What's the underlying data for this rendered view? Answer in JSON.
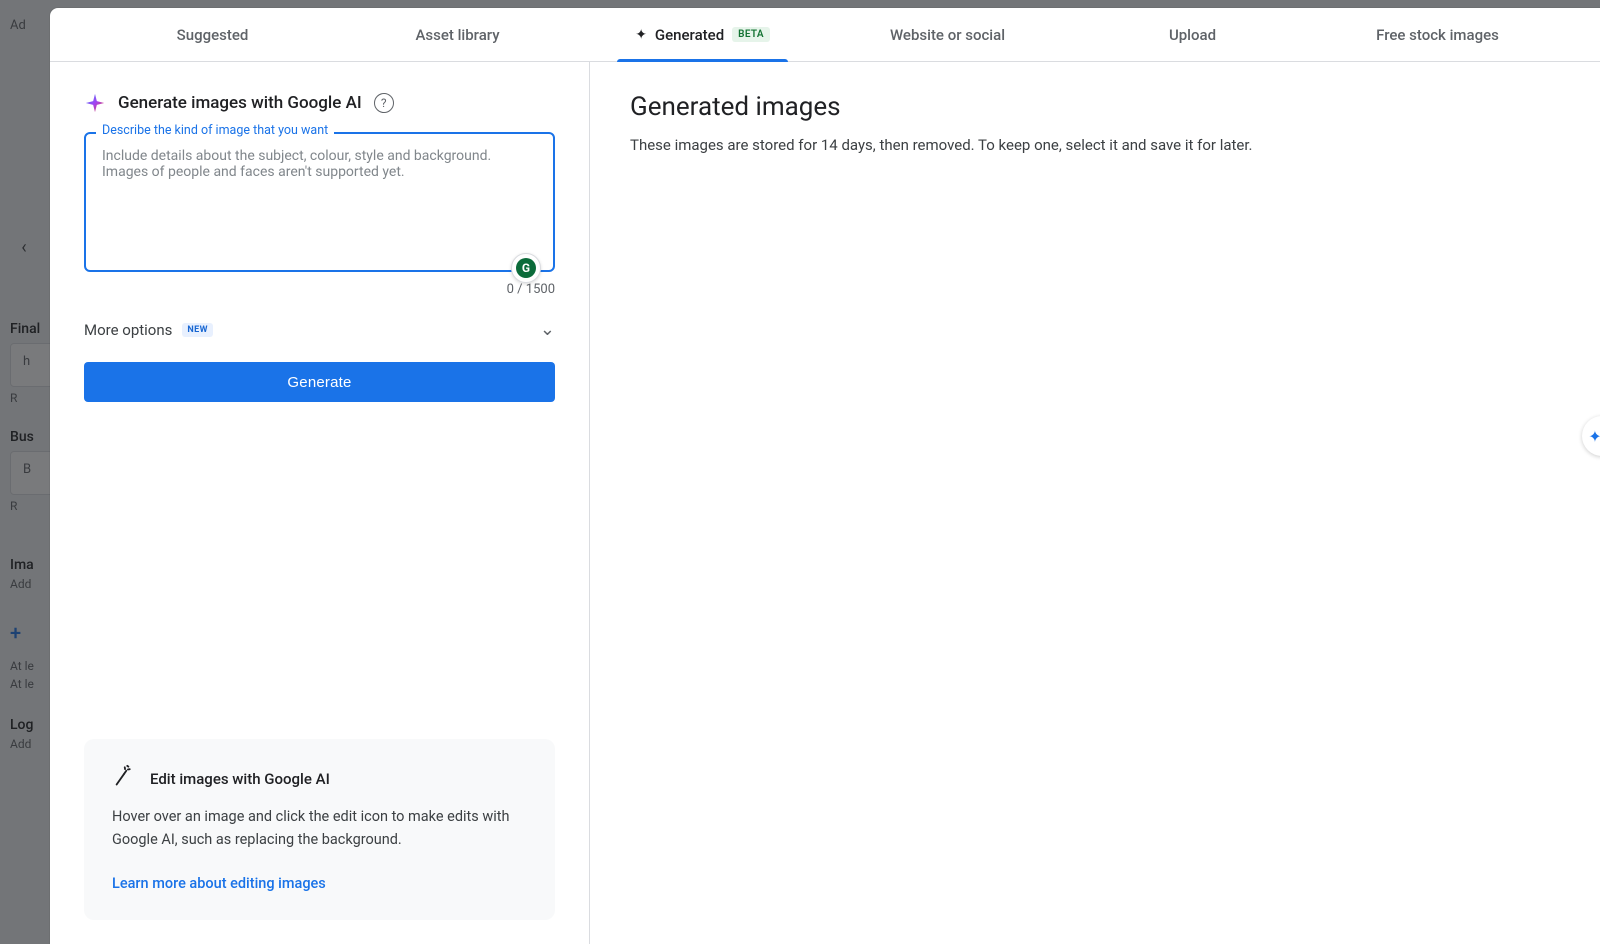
{
  "background": {
    "ad_label": "Ad",
    "back_chevron": "‹",
    "final_label": "Final",
    "final_value": "h",
    "final_req": "R",
    "business_label": "Bus",
    "business_value": "B",
    "business_req": "R",
    "images_label": "Ima",
    "images_sub": "Add",
    "plus": "+",
    "atleast1": "At le",
    "atleast2": "At le",
    "logo_label": "Log",
    "logo_sub": "Add"
  },
  "tabs": {
    "suggested": "Suggested",
    "asset_library": "Asset library",
    "generated": "Generated",
    "generated_badge": "BETA",
    "website_or_social": "Website or social",
    "upload": "Upload",
    "free_stock": "Free stock images"
  },
  "generate_panel": {
    "title": "Generate images with Google AI",
    "help_glyph": "?",
    "field_label": "Describe the kind of image that you want",
    "placeholder": "Include details about the subject, colour, style and background. Images of people and faces aren't supported yet.",
    "counter": "0 / 1500",
    "more_options_label": "More options",
    "more_options_badge": "NEW",
    "generate_button": "Generate",
    "grammarly_glyph": "G"
  },
  "edit_card": {
    "title": "Edit images with Google AI",
    "body": "Hover over an image and click the edit icon to make edits with Google AI, such as replacing the background.",
    "link": "Learn more about editing images"
  },
  "right": {
    "title": "Generated images",
    "subtitle": "These images are stored for 14 days, then removed. To keep one, select it and save it for later."
  }
}
